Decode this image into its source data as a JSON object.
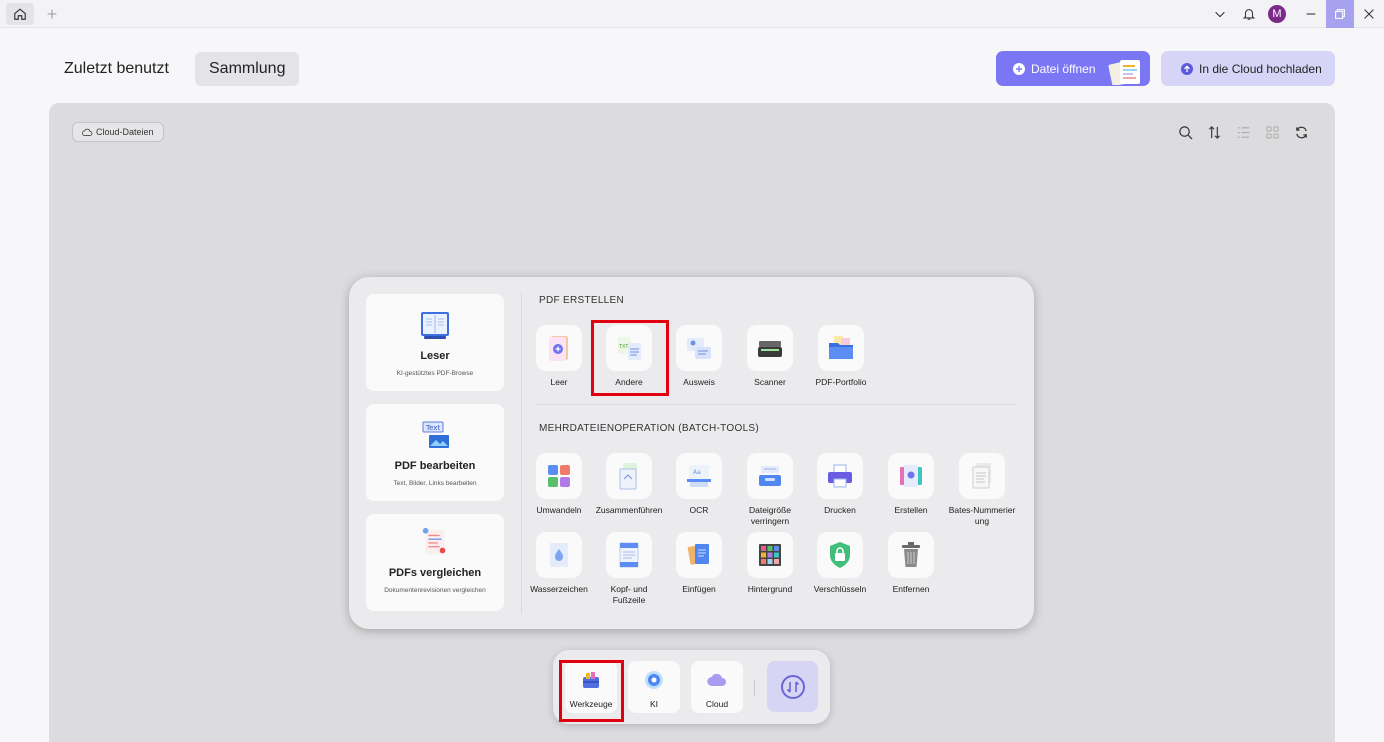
{
  "window": {
    "home_icon": "home-icon",
    "new_tab_icon": "plus-icon",
    "avatar_initial": "M"
  },
  "header": {
    "tabs": [
      {
        "label": "Zuletzt benutzt",
        "active": false
      },
      {
        "label": "Sammlung",
        "active": true
      }
    ],
    "open_file_label": "Datei öffnen",
    "cloud_upload_label": "In die Cloud hochladen"
  },
  "content": {
    "cloud_chip_label": "Cloud-Dateien"
  },
  "panel": {
    "cards": [
      {
        "title": "Leser",
        "subtitle": "KI-gestütztes PDF-Browse"
      },
      {
        "title": "PDF bearbeiten",
        "subtitle": "Text, Bilder, Links bearbeiten"
      },
      {
        "title": "PDFs vergleichen",
        "subtitle": "Dokumentenrevisionen vergleichen"
      }
    ],
    "create_section_title": "PDF ERSTELLEN",
    "create_tools": [
      {
        "label": "Leer"
      },
      {
        "label": "Andere",
        "highlighted": true
      },
      {
        "label": "Ausweis"
      },
      {
        "label": "Scanner"
      },
      {
        "label": "PDF-Portfolio"
      }
    ],
    "batch_section_title": "MEHRDATEIENOPERATION (BATCH-TOOLS)",
    "batch_tools": [
      {
        "label": "Umwandeln"
      },
      {
        "label": "Zusammenführen"
      },
      {
        "label": "OCR"
      },
      {
        "label": "Dateigröße verringern"
      },
      {
        "label": "Drucken"
      },
      {
        "label": "Erstellen"
      },
      {
        "label": "Bates-Nummerier ung"
      },
      {
        "label": "Wasserzeichen"
      },
      {
        "label": "Kopf- und Fußzeile"
      },
      {
        "label": "Einfügen"
      },
      {
        "label": "Hintergrund"
      },
      {
        "label": "Verschlüsseln"
      },
      {
        "label": "Entfernen"
      }
    ]
  },
  "dock": {
    "items": [
      {
        "label": "Werkzeuge",
        "highlighted": true
      },
      {
        "label": "KI"
      },
      {
        "label": "Cloud"
      }
    ]
  },
  "colors": {
    "accent": "#7b76f4",
    "accent_light": "#d6d5f8",
    "highlight": "#e00010"
  }
}
